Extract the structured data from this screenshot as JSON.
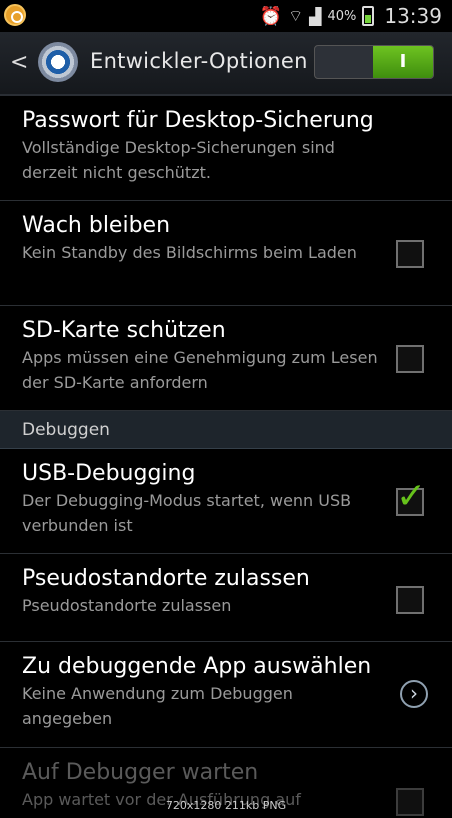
{
  "status_bar": {
    "battery_percent": "40%",
    "time": "13:39"
  },
  "action_bar": {
    "title": "Entwickler-Optionen",
    "toggle_label": "I"
  },
  "items": [
    {
      "title": "Passwort für Desktop-Sicherung",
      "subtitle": "Vollständige Desktop-Sicherungen sind derzeit nicht geschützt."
    },
    {
      "title": "Wach bleiben",
      "subtitle": "Kein Standby des Bildschirms beim Laden",
      "checked": false
    },
    {
      "title": "SD-Karte schützen",
      "subtitle": "Apps müssen eine Genehmigung zum Lesen der SD-Karte anfordern",
      "checked": false
    },
    {
      "section": "Debuggen"
    },
    {
      "title": "USB-Debugging",
      "subtitle": "Der Debugging-Modus startet, wenn USB verbunden ist",
      "checked": true
    },
    {
      "title": "Pseudostandorte zulassen",
      "subtitle": "Pseudostandorte zulassen",
      "checked": false
    },
    {
      "title": "Zu debuggende App auswählen",
      "subtitle": "Keine Anwendung zum Debuggen angegeben"
    },
    {
      "title": "Auf Debugger warten",
      "subtitle": "App wartet vor der Ausführung auf",
      "checked": false,
      "disabled": true
    }
  ],
  "watermark": "720x1280 211kb PNG"
}
